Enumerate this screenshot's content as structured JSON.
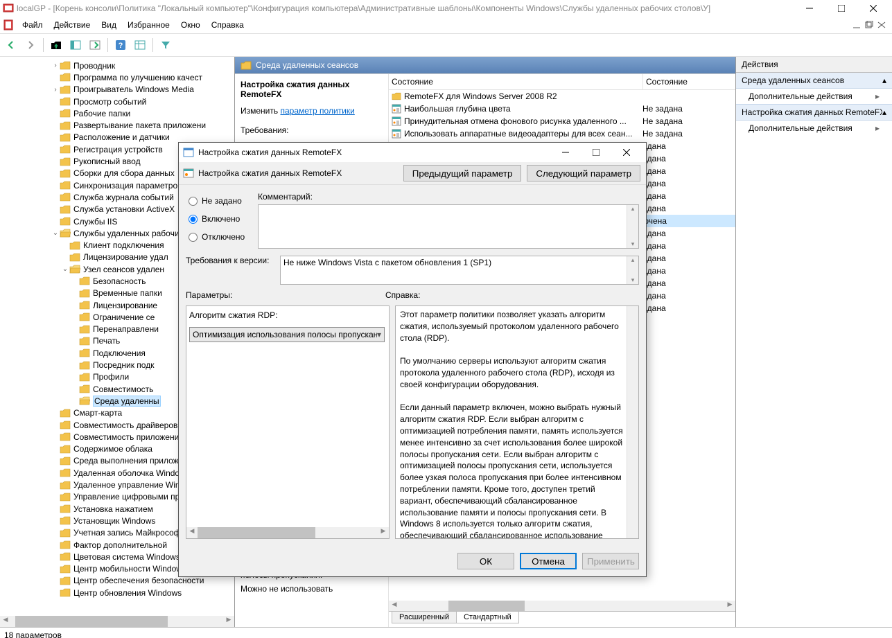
{
  "app": {
    "title": "localGP - [Корень консоли\\Политика \"Локальный компьютер\"\\Конфигурация компьютера\\Административные шаблоны\\Компоненты Windows\\Службы удаленных рабочих столов\\У]"
  },
  "menu": {
    "file": "Файл",
    "action": "Действие",
    "view": "Вид",
    "fav": "Избранное",
    "window": "Окно",
    "help": "Справка"
  },
  "tree": [
    {
      "d": 5,
      "t": "",
      "e": ">",
      "l": "Проводник"
    },
    {
      "d": 5,
      "t": "",
      "e": "",
      "l": "Программа по улучшению качест"
    },
    {
      "d": 5,
      "t": "",
      "e": ">",
      "l": "Проигрыватель Windows Media"
    },
    {
      "d": 5,
      "t": "",
      "e": "",
      "l": "Просмотр событий"
    },
    {
      "d": 5,
      "t": "",
      "e": "",
      "l": "Рабочие папки"
    },
    {
      "d": 5,
      "t": "",
      "e": "",
      "l": "Развертывание пакета приложени"
    },
    {
      "d": 5,
      "t": "",
      "e": "",
      "l": "Расположение и датчики"
    },
    {
      "d": 5,
      "t": "",
      "e": "",
      "l": "Регистрация устройств"
    },
    {
      "d": 5,
      "t": "",
      "e": "",
      "l": "Рукописный ввод"
    },
    {
      "d": 5,
      "t": "",
      "e": "",
      "l": "Сборки для сбора данных"
    },
    {
      "d": 5,
      "t": "",
      "e": "",
      "l": "Синхронизация параметров"
    },
    {
      "d": 5,
      "t": "",
      "e": "",
      "l": "Служба журнала событий"
    },
    {
      "d": 5,
      "t": "",
      "e": "",
      "l": "Служба установки ActiveX"
    },
    {
      "d": 5,
      "t": "",
      "e": "",
      "l": "Службы IIS"
    },
    {
      "d": 5,
      "t": "",
      "e": "v",
      "l": "Службы удаленных рабочих столов",
      "open": true
    },
    {
      "d": 6,
      "t": "",
      "e": "",
      "l": "Клиент подключения"
    },
    {
      "d": 6,
      "t": "",
      "e": "",
      "l": "Лицензирование удал"
    },
    {
      "d": 6,
      "t": "",
      "e": "v",
      "l": "Узел сеансов удален",
      "open": true
    },
    {
      "d": 7,
      "t": "",
      "e": "",
      "l": "Безопасность"
    },
    {
      "d": 7,
      "t": "",
      "e": "",
      "l": "Временные папки"
    },
    {
      "d": 7,
      "t": "",
      "e": "",
      "l": "Лицензирование"
    },
    {
      "d": 7,
      "t": "",
      "e": "",
      "l": "Ограничение се"
    },
    {
      "d": 7,
      "t": "",
      "e": "",
      "l": "Перенаправлени"
    },
    {
      "d": 7,
      "t": "",
      "e": "",
      "l": "Печать"
    },
    {
      "d": 7,
      "t": "",
      "e": "",
      "l": "Подключения"
    },
    {
      "d": 7,
      "t": "",
      "e": "",
      "l": "Посредник подк"
    },
    {
      "d": 7,
      "t": "",
      "e": "",
      "l": "Профили"
    },
    {
      "d": 7,
      "t": "",
      "e": "",
      "l": "Совместимость"
    },
    {
      "d": 7,
      "t": "",
      "e": "",
      "l": "Среда удаленны",
      "sel": true,
      "open": true
    },
    {
      "d": 5,
      "t": "",
      "e": "",
      "l": "Смарт-карта"
    },
    {
      "d": 5,
      "t": "",
      "e": "",
      "l": "Совместимость драйверов"
    },
    {
      "d": 5,
      "t": "",
      "e": "",
      "l": "Совместимость приложений"
    },
    {
      "d": 5,
      "t": "",
      "e": "",
      "l": "Содержимое облака"
    },
    {
      "d": 5,
      "t": "",
      "e": "",
      "l": "Среда выполнения приложений"
    },
    {
      "d": 5,
      "t": "",
      "e": "",
      "l": "Удаленная оболочка Windows"
    },
    {
      "d": 5,
      "t": "",
      "e": "",
      "l": "Удаленное управление Windows"
    },
    {
      "d": 5,
      "t": "",
      "e": "",
      "l": "Управление цифровыми правами"
    },
    {
      "d": 5,
      "t": "",
      "e": "",
      "l": "Установка нажатием"
    },
    {
      "d": 5,
      "t": "",
      "e": "",
      "l": "Установщик Windows"
    },
    {
      "d": 5,
      "t": "",
      "e": "",
      "l": "Учетная запись Майкрософт"
    },
    {
      "d": 5,
      "t": "",
      "e": "",
      "l": "Фактор дополнительной"
    },
    {
      "d": 5,
      "t": "",
      "e": "",
      "l": "Цветовая система Windows"
    },
    {
      "d": 5,
      "t": "",
      "e": "",
      "l": "Центр мобильности Windows"
    },
    {
      "d": 5,
      "t": "",
      "e": "",
      "l": "Центр обеспечения безопасности"
    },
    {
      "d": 5,
      "t": "",
      "e": "",
      "l": "Центр обновления Windows"
    }
  ],
  "mid": {
    "header": "Среда удаленных сеансов",
    "policy_name": "Настройка сжатия данных RemoteFX",
    "edit_label": "Изменить",
    "edit_link": "параметр политики",
    "req_label": "Требования:",
    "desc_tail_1": "полосы пропускания.",
    "desc_tail_2": "Можно не использовать",
    "col_state": "Состояние",
    "rows": [
      {
        "n": "RemoteFX для Windows Server 2008 R2",
        "s": ""
      },
      {
        "n": "Наибольшая глубина цвета",
        "s": "Не задана"
      },
      {
        "n": "Принудительная отмена фонового рисунка удаленного ...",
        "s": "Не задана"
      },
      {
        "n": "Использовать аппаратные видеоадаптеры для всех сеан...",
        "s": "Не задана"
      },
      {
        "n": "",
        "s": "адана"
      },
      {
        "n": "",
        "s": "адана"
      },
      {
        "n": "",
        "s": "адана"
      },
      {
        "n": "",
        "s": "адана"
      },
      {
        "n": "",
        "s": "адана"
      },
      {
        "n": "",
        "s": "адана"
      },
      {
        "n": "",
        "s": "ючена",
        "sel": true
      },
      {
        "n": "",
        "s": "адана"
      },
      {
        "n": "",
        "s": "адана"
      },
      {
        "n": "",
        "s": "адана"
      },
      {
        "n": "",
        "s": "адана"
      },
      {
        "n": "",
        "s": "адана"
      },
      {
        "n": "",
        "s": "адана"
      },
      {
        "n": "",
        "s": "адана"
      }
    ],
    "tab_ext": "Расширенный",
    "tab_std": "Стандартный"
  },
  "actions": {
    "header": "Действия",
    "group1": "Среда удаленных сеансов",
    "item1": "Дополнительные действия",
    "group2": "Настройка сжатия данных RemoteFX",
    "item2": "Дополнительные действия"
  },
  "dialog": {
    "title": "Настройка сжатия данных RemoteFX",
    "subtitle": "Настройка сжатия данных RemoteFX",
    "prev": "Предыдущий параметр",
    "next": "Следующий параметр",
    "r_notset": "Не задано",
    "r_enabled": "Включено",
    "r_disabled": "Отключено",
    "comment_label": "Комментарий:",
    "req_label": "Требования к версии:",
    "req_value": "Не ниже Windows Vista с пакетом обновления 1 (SP1)",
    "params_label": "Параметры:",
    "help_label": "Справка:",
    "param_name": "Алгоритм сжатия RDP:",
    "param_value": "Оптимизация использования полосы пропускания с",
    "help_text": "Этот параметр политики позволяет указать алгоритм сжатия, используемый протоколом удаленного рабочего стола (RDP).\n\nПо умолчанию серверы используют алгоритм сжатия протокола удаленного рабочего стола (RDP), исходя из своей конфигурации оборудования.\n\nЕсли данный параметр включен, можно выбрать нужный алгоритм сжатия RDP. Если выбран алгоритм с оптимизацией потребления памяти, память используется менее интенсивно за счет использования более широкой полосы пропускания сети. Если выбран алгоритм с оптимизацией полосы пропускания сети, используется более узкая полоса пропускания при более интенсивном потреблении памяти. Кроме того, доступен третий вариант, обеспечивающий сбалансированное использование памяти и полосы пропускания сети. В Windows 8 используется только алгоритм сжатия, обеспечивающий сбалансированное использование памяти и полосы пропускания",
    "ok": "ОК",
    "cancel": "Отмена",
    "apply": "Применить"
  },
  "status": "18 параметров"
}
